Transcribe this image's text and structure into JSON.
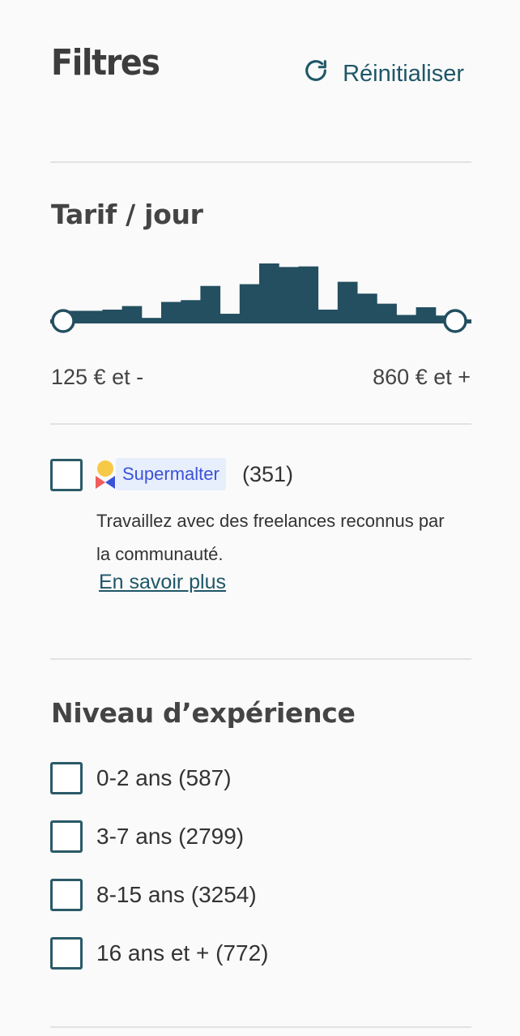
{
  "header": {
    "title": "Filtres",
    "reset_label": "Réinitialiser",
    "reset_icon": "refresh-icon"
  },
  "rate": {
    "title": "Tarif / jour",
    "min_label": "125 € et -",
    "max_label": "860 € et +",
    "selected_min_fraction": 0,
    "selected_max_fraction": 1,
    "histogram": [
      0.2,
      0.2,
      0.22,
      0.28,
      0.08,
      0.35,
      0.38,
      0.62,
      0.15,
      0.65,
      1.0,
      0.94,
      0.95,
      0.22,
      0.69,
      0.49,
      0.32,
      0.13,
      0.26,
      0.12
    ]
  },
  "supermalter": {
    "badge": "Supermalter",
    "count": "(351)",
    "description": "Travaillez avec des freelances reconnus par la communauté.",
    "learn_more": "En savoir plus"
  },
  "experience": {
    "title": "Niveau d’expérience",
    "options": [
      {
        "label": "0-2 ans (587)"
      },
      {
        "label": "3-7 ans (2799)"
      },
      {
        "label": "8-15 ans (3254)"
      },
      {
        "label": "16 ans et + (772)"
      }
    ]
  },
  "colors": {
    "accent": "#1f5668",
    "bar": "#234f60",
    "badge_bg": "#e7eefc",
    "badge_text": "#3b53d8"
  }
}
